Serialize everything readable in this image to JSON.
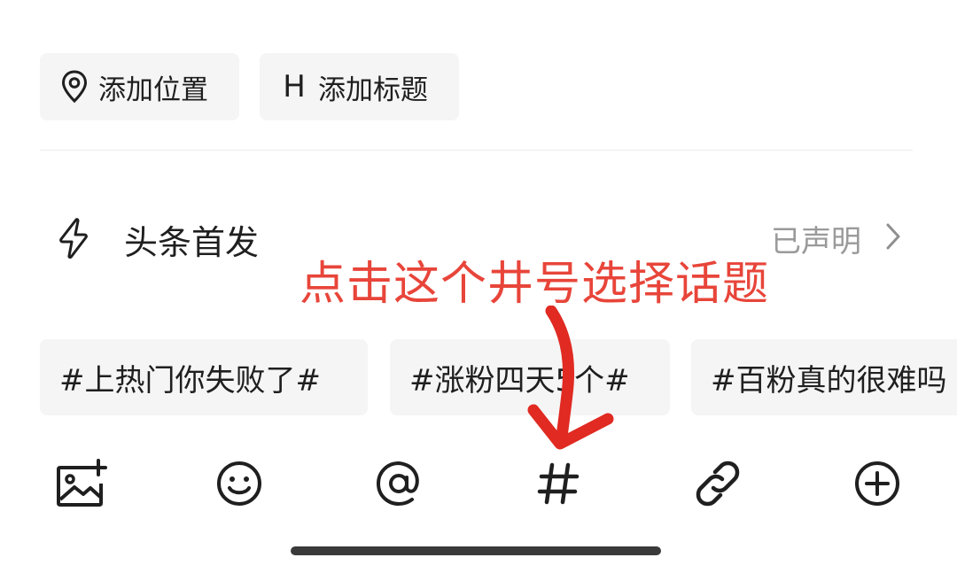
{
  "chips": {
    "location_label": "添加位置",
    "title_label": "添加标题",
    "title_glyph": "H"
  },
  "first_publish": {
    "label": "头条首发",
    "value": "已声明"
  },
  "annotation": {
    "text": "点击这个井号选择话题",
    "color": "#e8453a"
  },
  "topics": [
    {
      "label": "#上热门你失败了#"
    },
    {
      "label": "#涨粉四天5个#"
    },
    {
      "label": "#百粉真的很难吗"
    }
  ],
  "toolbar": {
    "icons": [
      "image-add-icon",
      "emoji-icon",
      "at-mention-icon",
      "hashtag-icon",
      "link-icon",
      "add-circle-icon"
    ]
  }
}
